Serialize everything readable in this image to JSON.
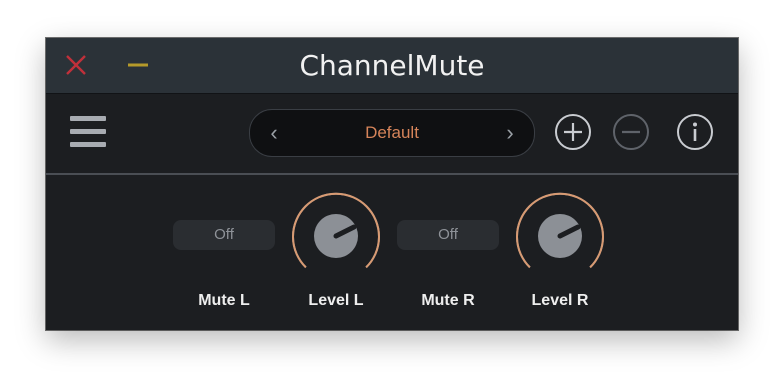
{
  "window": {
    "title": "ChannelMute"
  },
  "titlebar": {
    "close_icon": "close-icon",
    "minimize_icon": "minimize-icon",
    "close_color": "#c0303a",
    "minimize_color": "#b59a2a"
  },
  "toolbar": {
    "menu_icon": "hamburger-menu-icon",
    "preset": {
      "name": "Default",
      "prev_icon": "chevron-left-icon",
      "next_icon": "chevron-right-icon",
      "prev_glyph": "‹",
      "next_glyph": "›"
    },
    "add_icon": "plus-circle-icon",
    "remove_icon": "minus-circle-icon",
    "info_icon": "info-circle-icon"
  },
  "controls": {
    "mute_l": {
      "label": "Mute L",
      "state": "Off"
    },
    "level_l": {
      "label": "Level L",
      "value": 1.0
    },
    "mute_r": {
      "label": "Mute R",
      "state": "Off"
    },
    "level_r": {
      "label": "Level R",
      "value": 1.0
    }
  },
  "colors": {
    "accent": "#d6845a",
    "knob_ring": "#d89a72",
    "knob_track": "#8a8e94",
    "knob_body": "#8c9096",
    "background": "#1c1e21"
  }
}
